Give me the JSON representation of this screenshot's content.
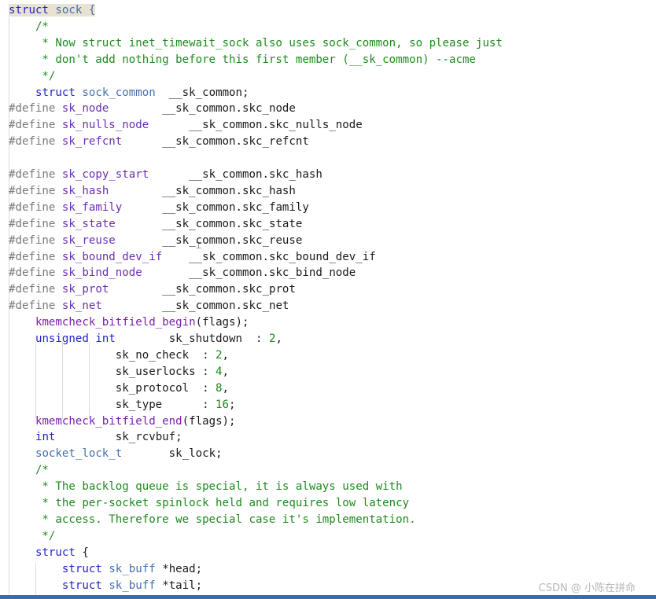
{
  "colors": {
    "keyword": "#2323c7",
    "type": "#4570b0",
    "macro": "#6b2fb3",
    "directive": "#7a7a7a",
    "comment": "#1f8a1f",
    "number": "#1a8a1a",
    "plain": "#1a1a1a",
    "function": "#7a1fb0",
    "highlight": "#e8e2d2"
  },
  "code_lines": [
    [
      [
        "struct",
        "keyword",
        1
      ],
      [
        " ",
        "plain",
        1
      ],
      [
        "sock",
        "type",
        1
      ],
      [
        " {",
        "type",
        1
      ]
    ],
    [
      [
        "    /*",
        "comment"
      ]
    ],
    [
      [
        "     * Now struct inet_timewait_sock also uses sock_common, so please just",
        "comment"
      ]
    ],
    [
      [
        "     * don't add nothing before this first member (__sk_common) --acme",
        "comment"
      ]
    ],
    [
      [
        "     */",
        "comment"
      ]
    ],
    [
      [
        "    ",
        "plain"
      ],
      [
        "struct",
        "keyword"
      ],
      [
        " ",
        "plain"
      ],
      [
        "sock_common",
        "type"
      ],
      [
        "  __sk_common;",
        "plain"
      ]
    ],
    [
      [
        "#define",
        "directive"
      ],
      [
        " ",
        "plain"
      ],
      [
        "sk_node",
        "macro"
      ],
      [
        "        __sk_common.skc_node",
        "plain"
      ]
    ],
    [
      [
        "#define",
        "directive"
      ],
      [
        " ",
        "plain"
      ],
      [
        "sk_nulls_node",
        "macro"
      ],
      [
        "      __sk_common.skc_nulls_node",
        "plain"
      ]
    ],
    [
      [
        "#define",
        "directive"
      ],
      [
        " ",
        "plain"
      ],
      [
        "sk_refcnt",
        "macro"
      ],
      [
        "      __sk_common.skc_refcnt",
        "plain"
      ]
    ],
    [],
    [
      [
        "#define",
        "directive"
      ],
      [
        " ",
        "plain"
      ],
      [
        "sk_copy_start",
        "macro"
      ],
      [
        "      __sk_common.skc_hash",
        "plain"
      ]
    ],
    [
      [
        "#define",
        "directive"
      ],
      [
        " ",
        "plain"
      ],
      [
        "sk_hash",
        "macro"
      ],
      [
        "        __sk_common.skc_hash",
        "plain"
      ]
    ],
    [
      [
        "#define",
        "directive"
      ],
      [
        " ",
        "plain"
      ],
      [
        "sk_family",
        "macro"
      ],
      [
        "      __sk_common.skc_family",
        "plain"
      ]
    ],
    [
      [
        "#define",
        "directive"
      ],
      [
        " ",
        "plain"
      ],
      [
        "sk_state",
        "macro"
      ],
      [
        "       __sk_common.skc_state",
        "plain"
      ]
    ],
    [
      [
        "#define",
        "directive"
      ],
      [
        " ",
        "plain"
      ],
      [
        "sk_reuse",
        "macro"
      ],
      [
        "       __sk_common.skc_reuse",
        "plain"
      ]
    ],
    [
      [
        "#define",
        "directive"
      ],
      [
        " ",
        "plain"
      ],
      [
        "sk_bound_dev_if",
        "macro"
      ],
      [
        "    __sk_common.skc_bound_dev_if",
        "plain"
      ]
    ],
    [
      [
        "#define",
        "directive"
      ],
      [
        " ",
        "plain"
      ],
      [
        "sk_bind_node",
        "macro"
      ],
      [
        "       __sk_common.skc_bind_node",
        "plain"
      ]
    ],
    [
      [
        "#define",
        "directive"
      ],
      [
        " ",
        "plain"
      ],
      [
        "sk_prot",
        "macro"
      ],
      [
        "        __sk_common.skc_prot",
        "plain"
      ]
    ],
    [
      [
        "#define",
        "directive"
      ],
      [
        " ",
        "plain"
      ],
      [
        "sk_net",
        "macro"
      ],
      [
        "         __sk_common.skc_net",
        "plain"
      ]
    ],
    [
      [
        "    ",
        "plain"
      ],
      [
        "kmemcheck_bitfield_begin",
        "function"
      ],
      [
        "(flags);",
        "plain"
      ]
    ],
    [
      [
        "    ",
        "plain"
      ],
      [
        "unsigned",
        "keyword"
      ],
      [
        " ",
        "plain"
      ],
      [
        "int",
        "keyword"
      ],
      [
        "        sk_shutdown  : ",
        "plain"
      ],
      [
        "2",
        "number"
      ],
      [
        ",",
        "plain"
      ]
    ],
    [
      [
        "                ",
        "plain"
      ],
      [
        "sk_no_check  : ",
        "plain"
      ],
      [
        "2",
        "number"
      ],
      [
        ",",
        "plain"
      ]
    ],
    [
      [
        "                ",
        "plain"
      ],
      [
        "sk_userlocks : ",
        "plain"
      ],
      [
        "4",
        "number"
      ],
      [
        ",",
        "plain"
      ]
    ],
    [
      [
        "                ",
        "plain"
      ],
      [
        "sk_protocol  : ",
        "plain"
      ],
      [
        "8",
        "number"
      ],
      [
        ",",
        "plain"
      ]
    ],
    [
      [
        "                ",
        "plain"
      ],
      [
        "sk_type      : ",
        "plain"
      ],
      [
        "16",
        "number"
      ],
      [
        ";",
        "plain"
      ]
    ],
    [
      [
        "    ",
        "plain"
      ],
      [
        "kmemcheck_bitfield_end",
        "function"
      ],
      [
        "(flags);",
        "plain"
      ]
    ],
    [
      [
        "    ",
        "plain"
      ],
      [
        "int",
        "keyword"
      ],
      [
        "         sk_rcvbuf;",
        "plain"
      ]
    ],
    [
      [
        "    ",
        "plain"
      ],
      [
        "socket_lock_t",
        "type"
      ],
      [
        "       sk_lock;",
        "plain"
      ]
    ],
    [
      [
        "    /*",
        "comment"
      ]
    ],
    [
      [
        "     * The backlog queue is special, it is always used with",
        "comment"
      ]
    ],
    [
      [
        "     * the per-socket spinlock held and requires low latency",
        "comment"
      ]
    ],
    [
      [
        "     * access. Therefore we special case it's implementation.",
        "comment"
      ]
    ],
    [
      [
        "     */",
        "comment"
      ]
    ],
    [
      [
        "    ",
        "plain"
      ],
      [
        "struct",
        "keyword"
      ],
      [
        " {",
        "plain"
      ]
    ],
    [
      [
        "        ",
        "plain"
      ],
      [
        "struct",
        "keyword"
      ],
      [
        " ",
        "plain"
      ],
      [
        "sk_buff",
        "type"
      ],
      [
        " *head;",
        "plain"
      ]
    ],
    [
      [
        "        ",
        "plain"
      ],
      [
        "struct",
        "keyword"
      ],
      [
        " ",
        "plain"
      ],
      [
        "sk_buff",
        "type"
      ],
      [
        " *tail;",
        "plain"
      ]
    ]
  ],
  "watermark": "CSDN @ 小陈在拼命",
  "cursor_glyph": "⌶"
}
